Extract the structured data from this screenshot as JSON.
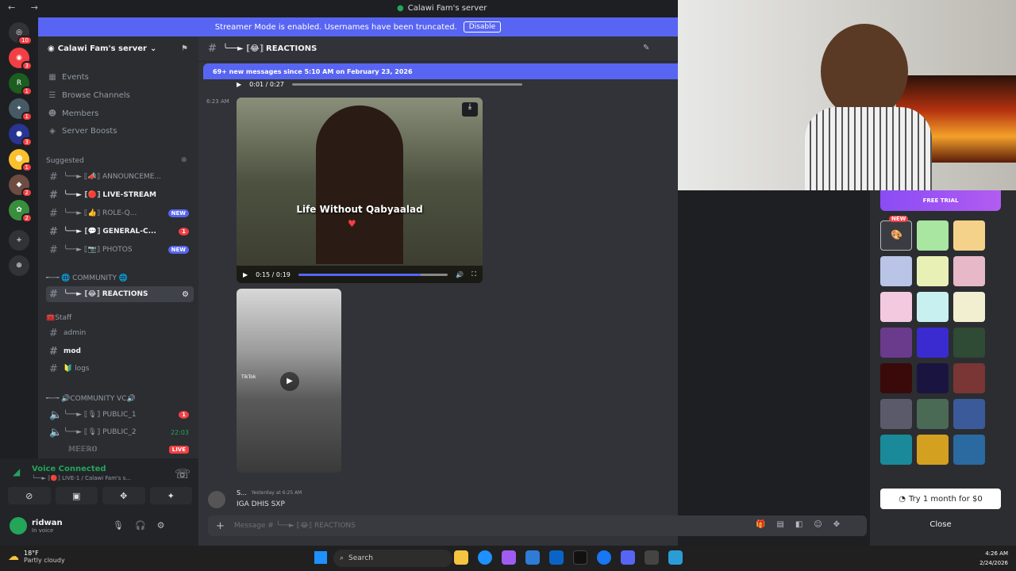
{
  "window": {
    "title": "Calawi Fam's server"
  },
  "banner": {
    "text": "Streamer Mode is enabled. Usernames have been truncated.",
    "button": "Disable"
  },
  "servers": [
    {
      "glyph": "◎",
      "badge": "10",
      "color": "#313338"
    },
    {
      "glyph": "◉",
      "badge": "3",
      "color": "#f23f43"
    },
    {
      "glyph": "R",
      "badge": "1",
      "color": "#1b5e20"
    },
    {
      "glyph": "✦",
      "badge": "1",
      "color": "#455a64"
    },
    {
      "glyph": "●",
      "badge": "3",
      "color": "#283593"
    },
    {
      "glyph": "☻",
      "badge": "1",
      "color": "#fbc02d"
    },
    {
      "glyph": "◆",
      "badge": "2",
      "color": "#6d4c41"
    },
    {
      "glyph": "✿",
      "badge": "2",
      "color": "#388e3c"
    }
  ],
  "sidebar": {
    "server_name": "Calawi Fam's server",
    "menu": [
      "Events",
      "Browse Channels",
      "Members",
      "Server Boosts"
    ],
    "suggested_label": "Suggested",
    "suggested": [
      {
        "name": "╰──► ⟦📣⟧ ANNOUNCEME...",
        "bold": false,
        "pill": ""
      },
      {
        "name": "╰──► ⟦🔴⟧ LIVE-STREAM",
        "bold": true,
        "pill": ""
      },
      {
        "name": "╰──► ⟦👍⟧ ROLE-Q...",
        "bold": false,
        "pill": "NEW"
      },
      {
        "name": "╰──► ⟦💬⟧ GENERAL-C...",
        "bold": true,
        "pill": "1"
      },
      {
        "name": "╰──► ⟦📷⟧ PHOTOS",
        "bold": false,
        "pill": "NEW"
      }
    ],
    "community_cat": "╾─╼ 🌐 COMMUNITY 🌐",
    "active_channel": "╰──► ⟦😂⟧ REACTIONS",
    "staff_cat": "🧰Staff",
    "staff": [
      "admin",
      "mod",
      "🔰 logs"
    ],
    "vc_cat": "╾─╼ 🔊COMMUNITY VC🔊",
    "voice_channels": [
      {
        "name": "╰──► ⟦🎙⟧ PUBLIC_1",
        "extra": "1"
      },
      {
        "name": "╰──► ⟦🎙⟧ PUBLIC_2",
        "extra": "22:03"
      }
    ],
    "voice_member": "𝕄𝔼𝔼ℝ𝕆",
    "voice_member_badge": "LIVE"
  },
  "voice": {
    "status": "Voice Connected",
    "channel": "╰──► ⟦🔴⟧ LIVE-1 / Calawi Fam's s...",
    "user": "ridwan",
    "user_status": "In voice"
  },
  "main": {
    "channel_title": "╰──► ⟦😂⟧ REACTIONS",
    "new_messages": "69+ new messages since 5:10 AM on February 23, 2026",
    "top_video_time": "0:01 / 0:27",
    "timestamp1": "6:23 AM",
    "video1": {
      "caption": "Life Without Qabyaalad",
      "time": "0:15 / 0:19",
      "progress": 0.82
    },
    "video2": {
      "label": "TikTok"
    },
    "msg": {
      "author": "S...",
      "time": "Yesterday at 6:25 AM",
      "text": "IGA DHIS SXP"
    },
    "input_placeholder": "Message # ╰──► ⟦😂⟧ REACTIONS"
  },
  "rpanel": {
    "free_trial": "FREE TRIAL",
    "new_badge": "NEW",
    "trial_button": "Try 1 month for $0",
    "close": "Close",
    "swatches": [
      "#3a3c42",
      "#a8e6a1",
      "#f5d28a",
      "#b9c4e6",
      "#e9f0b5",
      "#e6b8c8",
      "#f3c9e0",
      "#c8f0f0",
      "#f2eed0",
      "#6a3a8c",
      "#3a2bd1",
      "#2f4a35",
      "#3a0a0a",
      "#1a1540",
      "#7a3535",
      "#5a5a6a",
      "#4a6a55",
      "#3a5a9a",
      "#1a8a9a",
      "#d4a020",
      "#2a6aa0"
    ]
  },
  "taskbar": {
    "temp": "18°F",
    "weather": "Partly cloudy",
    "search": "Search",
    "time": "4:26 AM",
    "date": "2/24/2026"
  }
}
